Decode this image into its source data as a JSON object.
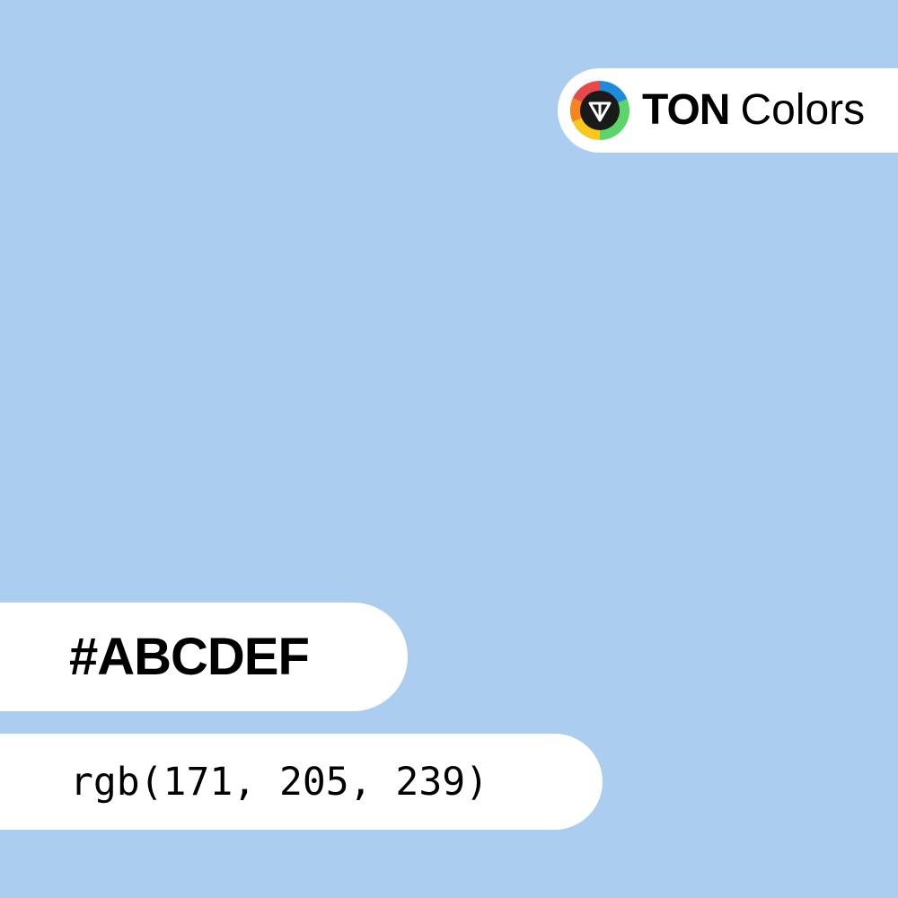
{
  "color": {
    "hex": "#ABCDEF",
    "rgb": "rgb(171, 205, 239)",
    "swatch": "#ABCDEF"
  },
  "brand": {
    "name_bold": "TON",
    "name_regular": "Colors",
    "logo_icon": "ton-diamond-color-wheel-icon",
    "logo_colors": [
      "#E8474B",
      "#1C8BDD",
      "#5AD66A",
      "#F9C81B",
      "#F7851E"
    ]
  }
}
